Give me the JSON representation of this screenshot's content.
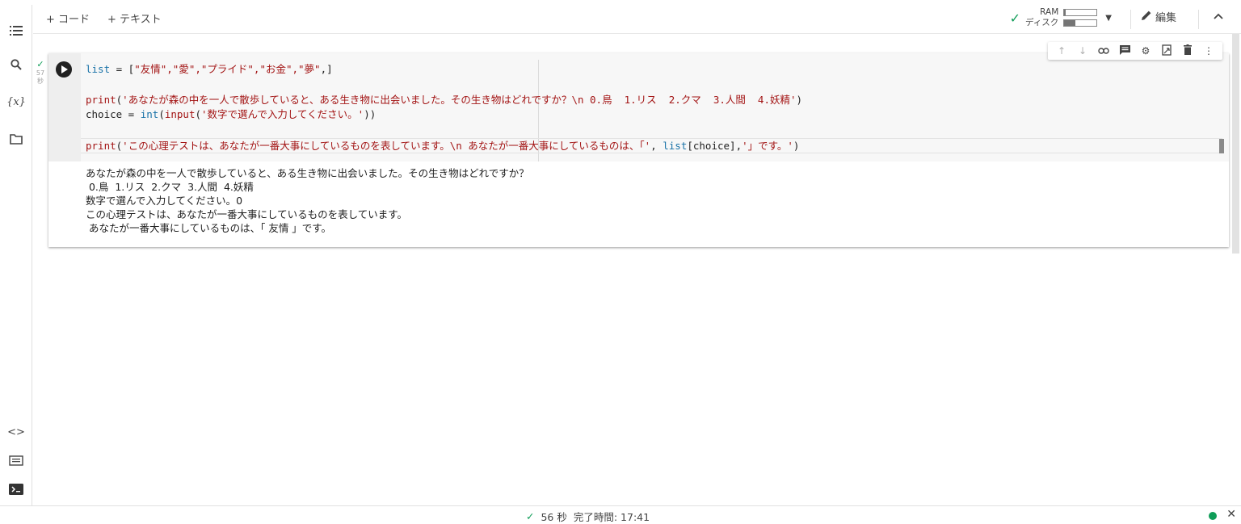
{
  "toolbar": {
    "add_code": "+ コード",
    "add_text": "+ テキスト",
    "ram_label": "RAM",
    "disk_label": "ディスク",
    "ram_usage": 0.05,
    "disk_usage": 0.35,
    "edit_label": "編集"
  },
  "exec": {
    "time": "57",
    "unit": "秒"
  },
  "code": {
    "line1": {
      "kw": "list",
      "rest1": " = [",
      "strs": "\"友情\",\"愛\",\"プライド\",\"お金\",\"夢\"",
      "rest2": ",]"
    },
    "line2": {
      "fn": "print",
      "open": "(",
      "str": "'あなたが森の中を一人で散歩していると、ある生き物に出会いました。その生き物はどれですか？\\n 0.鳥  1.リス  2.クマ  3.人間  4.妖精'",
      "close": ")"
    },
    "line3": {
      "pre": "choice = ",
      "kw1": "int",
      "p1": "(",
      "fn": "input",
      "p2": "(",
      "str": "'数字で選んで入力してください。'",
      "close": "))"
    },
    "line4": {
      "fn": "print",
      "open": "(",
      "str1": "'この心理テストは、あなたが一番大事にしているものを表しています。\\n あなたが一番大事にしているものは、「'",
      "mid1": ", ",
      "kw": "list",
      "mid2": "[choice],",
      "str2": "'」です。'",
      "close": ")"
    }
  },
  "output": [
    "あなたが森の中を一人で散歩していると、ある生き物に出会いました。その生き物はどれですか？",
    " 0.鳥  1.リス  2.クマ  3.人間  4.妖精",
    "数字で選んで入力してください。0",
    "この心理テストは、あなたが一番大事にしているものを表しています。",
    " あなたが一番大事にしているものは、「 友情 」です。"
  ],
  "statusbar": {
    "duration": "56 秒",
    "completed": "完了時間: 17:41"
  },
  "colors": {
    "accent_green": "#0f9d58",
    "keyword": "#1a73a8",
    "string": "#a31515"
  },
  "icons": [
    "toc-icon",
    "search-icon",
    "variables-icon",
    "folder-icon",
    "code-snippets-icon",
    "command-palette-icon",
    "terminal-icon",
    "run-icon",
    "check-icon",
    "pencil-icon",
    "chevron-up-icon",
    "arrow-up-icon",
    "arrow-down-icon",
    "link-icon",
    "comment-icon",
    "settings-icon",
    "mirror-cell-icon",
    "delete-icon",
    "more-vert-icon",
    "close-icon"
  ]
}
